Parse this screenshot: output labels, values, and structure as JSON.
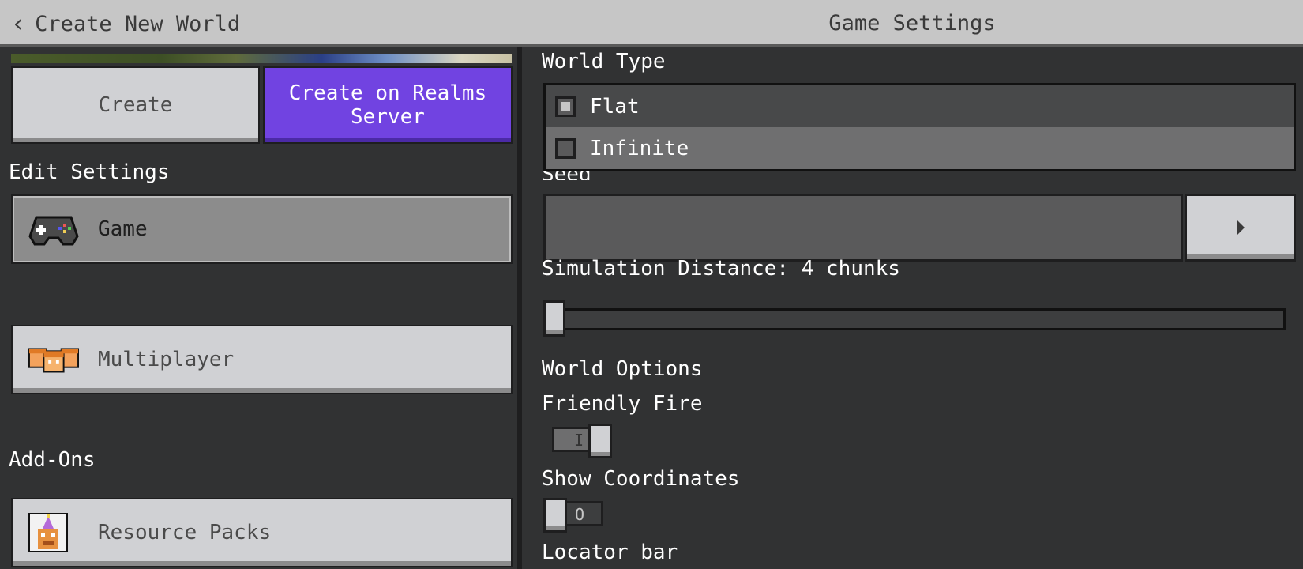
{
  "header": {
    "back_label": "Create New World",
    "title": "Game Settings"
  },
  "left": {
    "create_label": "Create",
    "realms_label": "Create on Realms Server",
    "edit_settings_label": "Edit Settings",
    "nav_items": [
      {
        "label": "Game",
        "icon": "controller-icon",
        "active": true
      },
      {
        "label": "Multiplayer",
        "icon": "players-icon",
        "active": false
      }
    ],
    "addons_label": "Add-Ons",
    "addon_items": [
      {
        "label": "Resource Packs",
        "icon": "resource-pack-icon"
      }
    ]
  },
  "right": {
    "world_type_label": "World Type",
    "world_type_options": [
      {
        "label": "Flat",
        "selected": true
      },
      {
        "label": "Infinite",
        "selected": false
      }
    ],
    "seed_label": "Seed",
    "seed_value": "",
    "simulation_distance_label": "Simulation Distance: 4 chunks",
    "simulation_distance_value": 4,
    "world_options_label": "World Options",
    "friendly_fire_label": "Friendly Fire",
    "friendly_fire_on": true,
    "show_coordinates_label": "Show Coordinates",
    "show_coordinates_on": false,
    "locator_bar_label": "Locator bar"
  },
  "colors": {
    "accent_purple": "#7143e1",
    "panel_bg": "#313233",
    "button_gray": "#d0d1d4"
  }
}
